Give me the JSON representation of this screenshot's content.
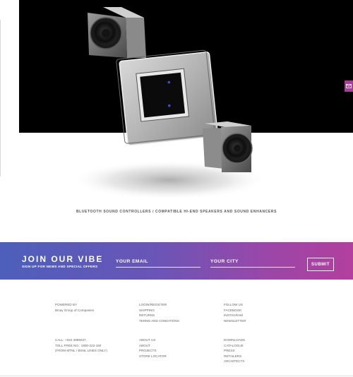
{
  "hero": {
    "alt": "Glass touch controller panel with two cube speakers"
  },
  "tagline": "BLUETOOTH SOUND CONTROLLERS / COMPATIBLE HI-END SPEAKERS AND SOUND ENHANCERS",
  "signup": {
    "title": "JOIN OUR VIBE",
    "subtitle": "SIGN UP FOR NEWS AND SPECIAL OFFERS",
    "email_placeholder": "YOUR EMAIL",
    "city_placeholder": "YOUR CITY",
    "submit_label": "SUBMIT"
  },
  "footer": {
    "powered_by_label": "POWERED BY",
    "company": "Binay Group of Companies",
    "contact": [
      "CALL: +022 3989337,",
      "TOLL FREE NO.: 1800-222-150",
      "(FROM MTNL / BSNL LINES ONLY)"
    ],
    "account_links": [
      "LOGIN/REGISTER",
      "SHIPPING",
      "RETURNS",
      "TERMS AND CONDITIONS"
    ],
    "about_links": [
      "ABOUT US",
      "ABOUT",
      "PROJECTS",
      "STORE LOCATOR"
    ],
    "social_links": [
      "FOLLOW US",
      "FACEBOOK",
      "INSTAGRAM",
      "NEWSLETTER"
    ],
    "resource_links": [
      "DOWNLOADS",
      "CATALOGUE",
      "PRESS",
      "RETAILERS",
      "ARCHITECTS"
    ]
  },
  "colors": {
    "gradient_start": "#4d5fbb",
    "gradient_end": "#b23f9e",
    "mail_tab": "#a43f93"
  },
  "icons": {
    "mail_tab": "envelope-icon"
  }
}
